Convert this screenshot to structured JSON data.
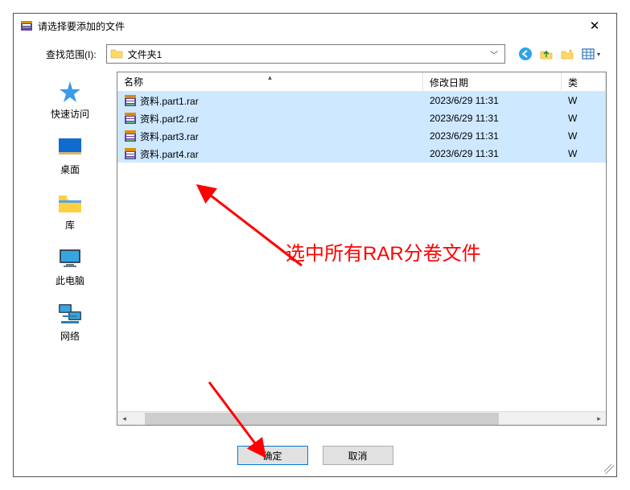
{
  "window": {
    "title": "请选择要添加的文件",
    "close_glyph": "✕"
  },
  "lookin": {
    "label": "查找范围(I):",
    "current_folder": "文件夹1",
    "dropdown_glyph": "﹀"
  },
  "nav": {
    "back": "←",
    "up": "↑",
    "newfolder": "✦",
    "viewmenu": "▦",
    "viewmenu_arrow": "▾"
  },
  "places": [
    {
      "key": "quickaccess",
      "label": "快速访问"
    },
    {
      "key": "desktop",
      "label": "桌面"
    },
    {
      "key": "libraries",
      "label": "库"
    },
    {
      "key": "thispc",
      "label": "此电脑"
    },
    {
      "key": "network",
      "label": "网络"
    }
  ],
  "columns": {
    "name": "名称",
    "date": "修改日期",
    "type": "类",
    "sort_glyph": "▲"
  },
  "files": [
    {
      "name": "资料.part1.rar",
      "date": "2023/6/29 11:31",
      "type": "W",
      "selected": true
    },
    {
      "name": "资料.part2.rar",
      "date": "2023/6/29 11:31",
      "type": "W",
      "selected": true
    },
    {
      "name": "资料.part3.rar",
      "date": "2023/6/29 11:31",
      "type": "W",
      "selected": true
    },
    {
      "name": "资料.part4.rar",
      "date": "2023/6/29 11:31",
      "type": "W",
      "selected": true
    }
  ],
  "buttons": {
    "ok": "确定",
    "cancel": "取消"
  },
  "annotation": {
    "text": "选中所有RAR分卷文件"
  }
}
